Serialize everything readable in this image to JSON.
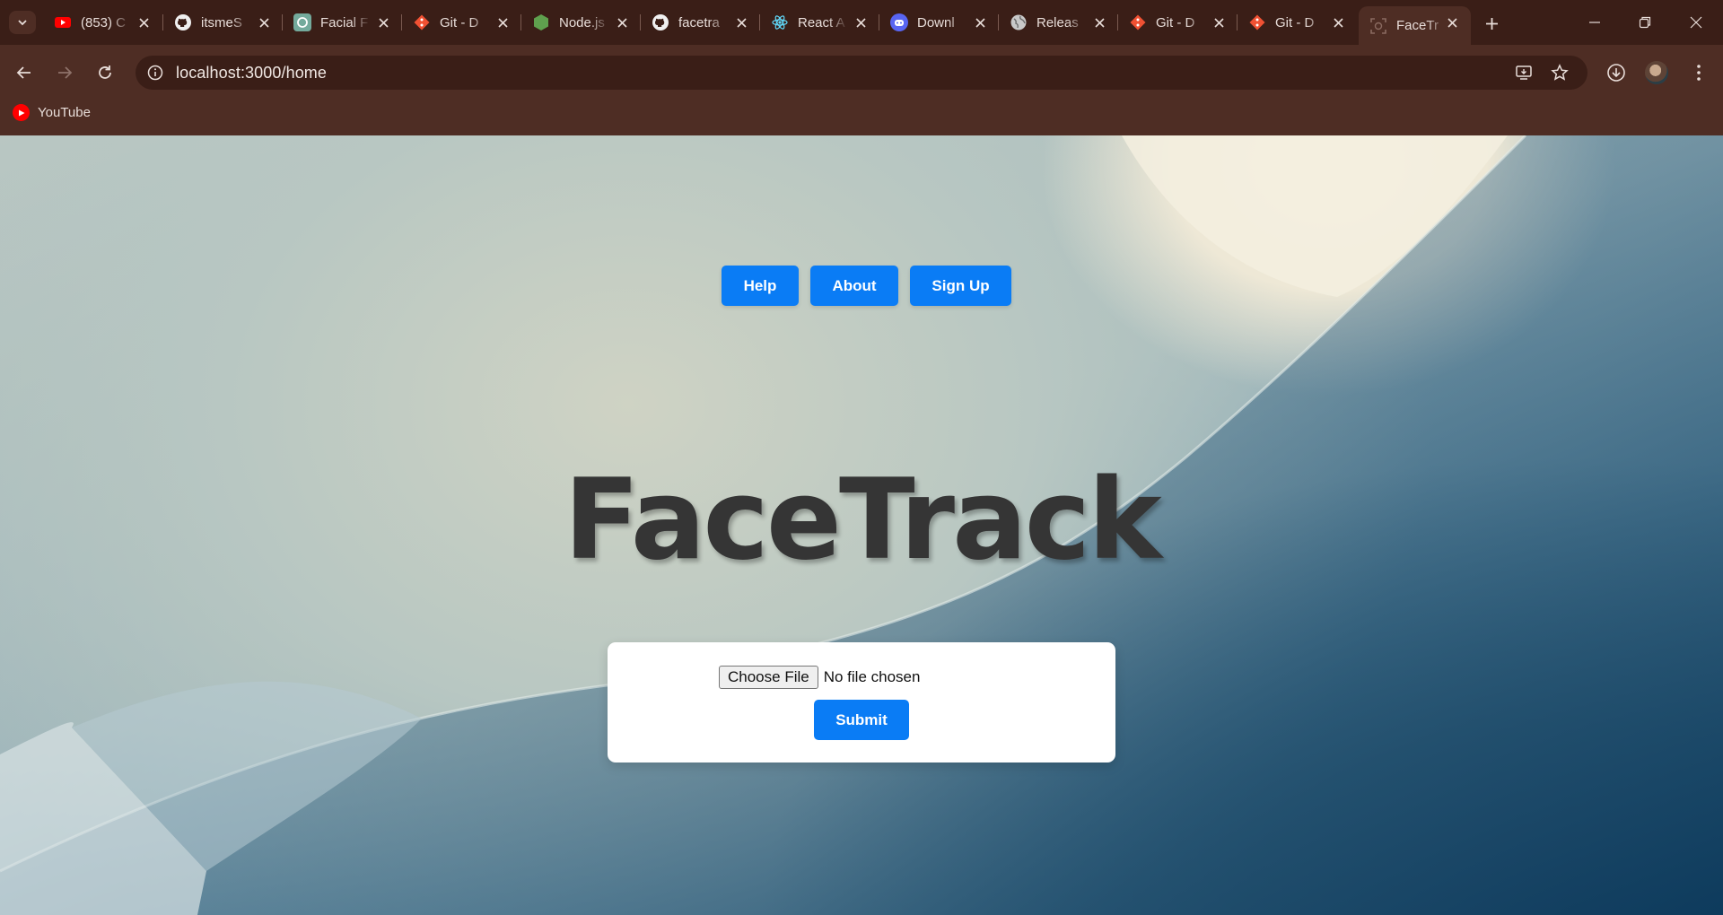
{
  "browser": {
    "tabs": [
      {
        "title": "(853) C",
        "icon": "youtube-icon"
      },
      {
        "title": "itsmeS",
        "icon": "github-icon"
      },
      {
        "title": "Facial F",
        "icon": "chatgpt-icon"
      },
      {
        "title": "Git - D",
        "icon": "git-icon"
      },
      {
        "title": "Node.js",
        "icon": "nodejs-icon"
      },
      {
        "title": "facetra",
        "icon": "github-icon"
      },
      {
        "title": "React A",
        "icon": "react-icon"
      },
      {
        "title": "Downl",
        "icon": "discord-icon"
      },
      {
        "title": "Releas",
        "icon": "globe-icon"
      },
      {
        "title": "Git - D",
        "icon": "git-icon"
      },
      {
        "title": "Git - D",
        "icon": "git-icon"
      },
      {
        "title": "FaceTr",
        "icon": "facetrack-icon",
        "active": true
      }
    ],
    "url": "localhost:3000/home",
    "bookmarks": [
      {
        "label": "YouTube",
        "icon": "youtube-icon"
      }
    ],
    "colors": {
      "chrome_dark": "#3a1e17",
      "chrome_light": "#4e2d24"
    }
  },
  "page": {
    "nav": {
      "help": "Help",
      "about": "About",
      "signup": "Sign Up"
    },
    "hero_title": "FaceTrack",
    "upload": {
      "choose_label": "Choose File",
      "file_status": "No file chosen",
      "submit_label": "Submit"
    },
    "colors": {
      "button": "#0a7cf5",
      "title": "#353535"
    }
  }
}
